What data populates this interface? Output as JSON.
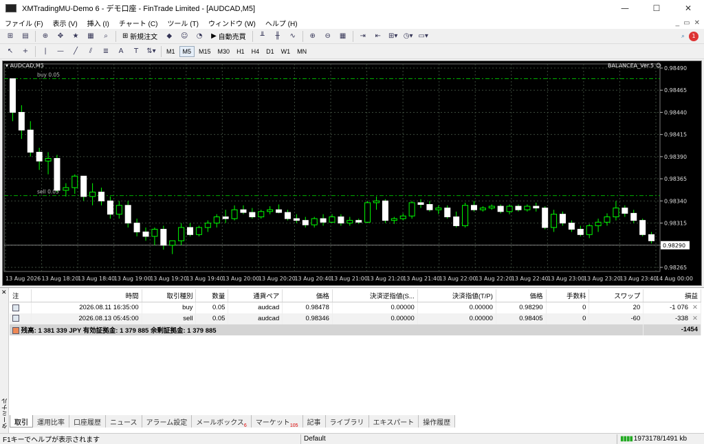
{
  "window": {
    "title": "XMTradingMU-Demo 6 - デモ口座 - FinTrade Limited - [AUDCAD,M5]",
    "min": "—",
    "max": "☐",
    "close": "✕"
  },
  "menu": [
    "ファイル (F)",
    "表示 (V)",
    "挿入 (I)",
    "チャート (C)",
    "ツール (T)",
    "ウィンドウ (W)",
    "ヘルプ (H)"
  ],
  "toolbar": {
    "new_order": "新規注文",
    "auto_trade": "自動売買"
  },
  "timeframes": [
    "M1",
    "M5",
    "M15",
    "M30",
    "H1",
    "H4",
    "D1",
    "W1",
    "MN"
  ],
  "active_timeframe": "M5",
  "chart": {
    "symbol_label": "AUDCAD,M5",
    "ea_label": "BALANCEA_Ver.5 ☺",
    "buy_line_label": "buy 0.05",
    "sell_line_label": "sell 0.05",
    "current_price": "0.98290"
  },
  "chart_data": {
    "type": "candlestick",
    "ylim": [
      0.98265,
      0.9849
    ],
    "y_ticks": [
      "0.98490",
      "0.98465",
      "0.98440",
      "0.98415",
      "0.98390",
      "0.98365",
      "0.98340",
      "0.98315",
      "0.98290",
      "0.98265"
    ],
    "x_ticks": [
      "13 Aug 2026",
      "13 Aug 18:20",
      "13 Aug 18:40",
      "13 Aug 19:00",
      "13 Aug 19:20",
      "13 Aug 19:40",
      "13 Aug 20:00",
      "13 Aug 20:20",
      "13 Aug 20:40",
      "13 Aug 21:00",
      "13 Aug 21:20",
      "13 Aug 21:40",
      "13 Aug 22:00",
      "13 Aug 22:20",
      "13 Aug 22:40",
      "13 Aug 23:00",
      "13 Aug 23:20",
      "13 Aug 23:40",
      "14 Aug 00:00"
    ],
    "buy_level": 0.98478,
    "sell_level": 0.98346,
    "bid_level": 0.9829,
    "candles": [
      [
        0.98478,
        0.98478,
        0.9843,
        0.9844
      ],
      [
        0.9844,
        0.98448,
        0.9841,
        0.9842
      ],
      [
        0.9842,
        0.9843,
        0.9839,
        0.98395
      ],
      [
        0.98395,
        0.984,
        0.98375,
        0.98385
      ],
      [
        0.98385,
        0.98395,
        0.9837,
        0.98388
      ],
      [
        0.98388,
        0.98392,
        0.9835,
        0.98352
      ],
      [
        0.98352,
        0.9836,
        0.98345,
        0.98355
      ],
      [
        0.98355,
        0.9837,
        0.98348,
        0.98368
      ],
      [
        0.98368,
        0.98368,
        0.9834,
        0.98345
      ],
      [
        0.98345,
        0.9836,
        0.98335,
        0.9835
      ],
      [
        0.9835,
        0.98355,
        0.98335,
        0.9834
      ],
      [
        0.9834,
        0.98345,
        0.9832,
        0.98325
      ],
      [
        0.98325,
        0.9834,
        0.9832,
        0.98335
      ],
      [
        0.98335,
        0.9834,
        0.9831,
        0.98315
      ],
      [
        0.98315,
        0.9832,
        0.983,
        0.98305
      ],
      [
        0.98305,
        0.9831,
        0.98295,
        0.983
      ],
      [
        0.983,
        0.9831,
        0.9829,
        0.98308
      ],
      [
        0.98308,
        0.98312,
        0.98285,
        0.9829
      ],
      [
        0.9829,
        0.98295,
        0.9828,
        0.98295
      ],
      [
        0.98295,
        0.98315,
        0.9829,
        0.9831
      ],
      [
        0.9831,
        0.98315,
        0.983,
        0.98302
      ],
      [
        0.98302,
        0.98312,
        0.983,
        0.9831
      ],
      [
        0.9831,
        0.98318,
        0.98305,
        0.98315
      ],
      [
        0.98315,
        0.98325,
        0.9831,
        0.98322
      ],
      [
        0.98322,
        0.9833,
        0.98315,
        0.9832
      ],
      [
        0.9832,
        0.98335,
        0.98318,
        0.9833
      ],
      [
        0.9833,
        0.98335,
        0.98325,
        0.98327
      ],
      [
        0.98327,
        0.98332,
        0.9832,
        0.98322
      ],
      [
        0.98322,
        0.9833,
        0.9832,
        0.98328
      ],
      [
        0.98328,
        0.98334,
        0.98325,
        0.9833
      ],
      [
        0.9833,
        0.98336,
        0.98326,
        0.98327
      ],
      [
        0.98327,
        0.9833,
        0.98318,
        0.9832
      ],
      [
        0.9832,
        0.98325,
        0.98315,
        0.98318
      ],
      [
        0.98318,
        0.98322,
        0.9831,
        0.98313
      ],
      [
        0.98313,
        0.98322,
        0.9831,
        0.9832
      ],
      [
        0.9832,
        0.98325,
        0.98312,
        0.98316
      ],
      [
        0.98316,
        0.98325,
        0.98315,
        0.98322
      ],
      [
        0.98322,
        0.98325,
        0.98312,
        0.98315
      ],
      [
        0.98315,
        0.98322,
        0.98312,
        0.98318
      ],
      [
        0.98318,
        0.9832,
        0.98314,
        0.98316
      ],
      [
        0.98316,
        0.9834,
        0.98315,
        0.98338
      ],
      [
        0.98338,
        0.98345,
        0.9833,
        0.9834
      ],
      [
        0.9834,
        0.98342,
        0.98315,
        0.98318
      ],
      [
        0.98318,
        0.98322,
        0.98314,
        0.9832
      ],
      [
        0.9832,
        0.98326,
        0.98318,
        0.98323
      ],
      [
        0.98323,
        0.9834,
        0.9832,
        0.98338
      ],
      [
        0.98338,
        0.98342,
        0.98332,
        0.98336
      ],
      [
        0.98336,
        0.9834,
        0.98328,
        0.9833
      ],
      [
        0.9833,
        0.98335,
        0.98325,
        0.98332
      ],
      [
        0.98332,
        0.98335,
        0.9832,
        0.98322
      ],
      [
        0.98322,
        0.98328,
        0.9831,
        0.98312
      ],
      [
        0.98312,
        0.98338,
        0.9831,
        0.98335
      ],
      [
        0.98335,
        0.9834,
        0.98328,
        0.9833
      ],
      [
        0.9833,
        0.98334,
        0.98328,
        0.98332
      ],
      [
        0.98332,
        0.98336,
        0.9833,
        0.98334
      ],
      [
        0.98334,
        0.98336,
        0.98326,
        0.98328
      ],
      [
        0.98328,
        0.98336,
        0.98325,
        0.98334
      ],
      [
        0.98334,
        0.98336,
        0.98328,
        0.9833
      ],
      [
        0.9833,
        0.98336,
        0.98328,
        0.98334
      ],
      [
        0.98334,
        0.98338,
        0.98328,
        0.98332
      ],
      [
        0.98332,
        0.98334,
        0.98308,
        0.9831
      ],
      [
        0.9831,
        0.9833,
        0.98305,
        0.98325
      ],
      [
        0.98325,
        0.98328,
        0.98312,
        0.98315
      ],
      [
        0.98315,
        0.98318,
        0.98305,
        0.98308
      ],
      [
        0.98308,
        0.98312,
        0.983,
        0.98302
      ],
      [
        0.98302,
        0.98314,
        0.98298,
        0.98312
      ],
      [
        0.98312,
        0.9832,
        0.98305,
        0.98316
      ],
      [
        0.98316,
        0.98326,
        0.98312,
        0.98322
      ],
      [
        0.98322,
        0.9834,
        0.98318,
        0.98332
      ],
      [
        0.98332,
        0.98335,
        0.98322,
        0.98326
      ],
      [
        0.98326,
        0.9833,
        0.98315,
        0.98318
      ],
      [
        0.98318,
        0.9832,
        0.983,
        0.98302
      ],
      [
        0.98302,
        0.98305,
        0.98292,
        0.98295
      ]
    ]
  },
  "terminal": {
    "side_label": "ターミナル",
    "columns": [
      "注",
      "時間",
      "取引種別",
      "数量",
      "通貨ペア",
      "価格",
      "決済逆指値(S...",
      "決済指値(T/P)",
      "価格",
      "手数料",
      "スワップ",
      "損益"
    ],
    "rows": [
      [
        "",
        "2026.08.11 16:35:00",
        "buy",
        "0.05",
        "audcad",
        "0.98478",
        "0.00000",
        "0.00000",
        "0.98290",
        "0",
        "20",
        "-1 076"
      ],
      [
        "",
        "2026.08.13 05:45:00",
        "sell",
        "0.05",
        "audcad",
        "0.98346",
        "0.00000",
        "0.00000",
        "0.98405",
        "0",
        "-60",
        "-338"
      ]
    ],
    "summary": "残高: 1 381 339 JPY  有効証拠金: 1 379 885  余剰証拠金: 1 379 885",
    "summary_total": "-1454",
    "tabs": [
      "取引",
      "運用比率",
      "口座履歴",
      "ニュース",
      "アラーム設定",
      "メールボックス",
      "マーケット",
      "記事",
      "ライブラリ",
      "エキスパート",
      "操作履歴"
    ],
    "mail_badge": "6",
    "market_badge": "105"
  },
  "status": {
    "help": "F1キーでヘルプが表示されます",
    "profile": "Default",
    "traffic": "1973178/1491 kb"
  },
  "colors": {
    "bull": "#ffffff",
    "bear": "#ffffff",
    "wick": "#00ff00",
    "grid": "#2a3d2a",
    "buy_line": "#00c000"
  }
}
